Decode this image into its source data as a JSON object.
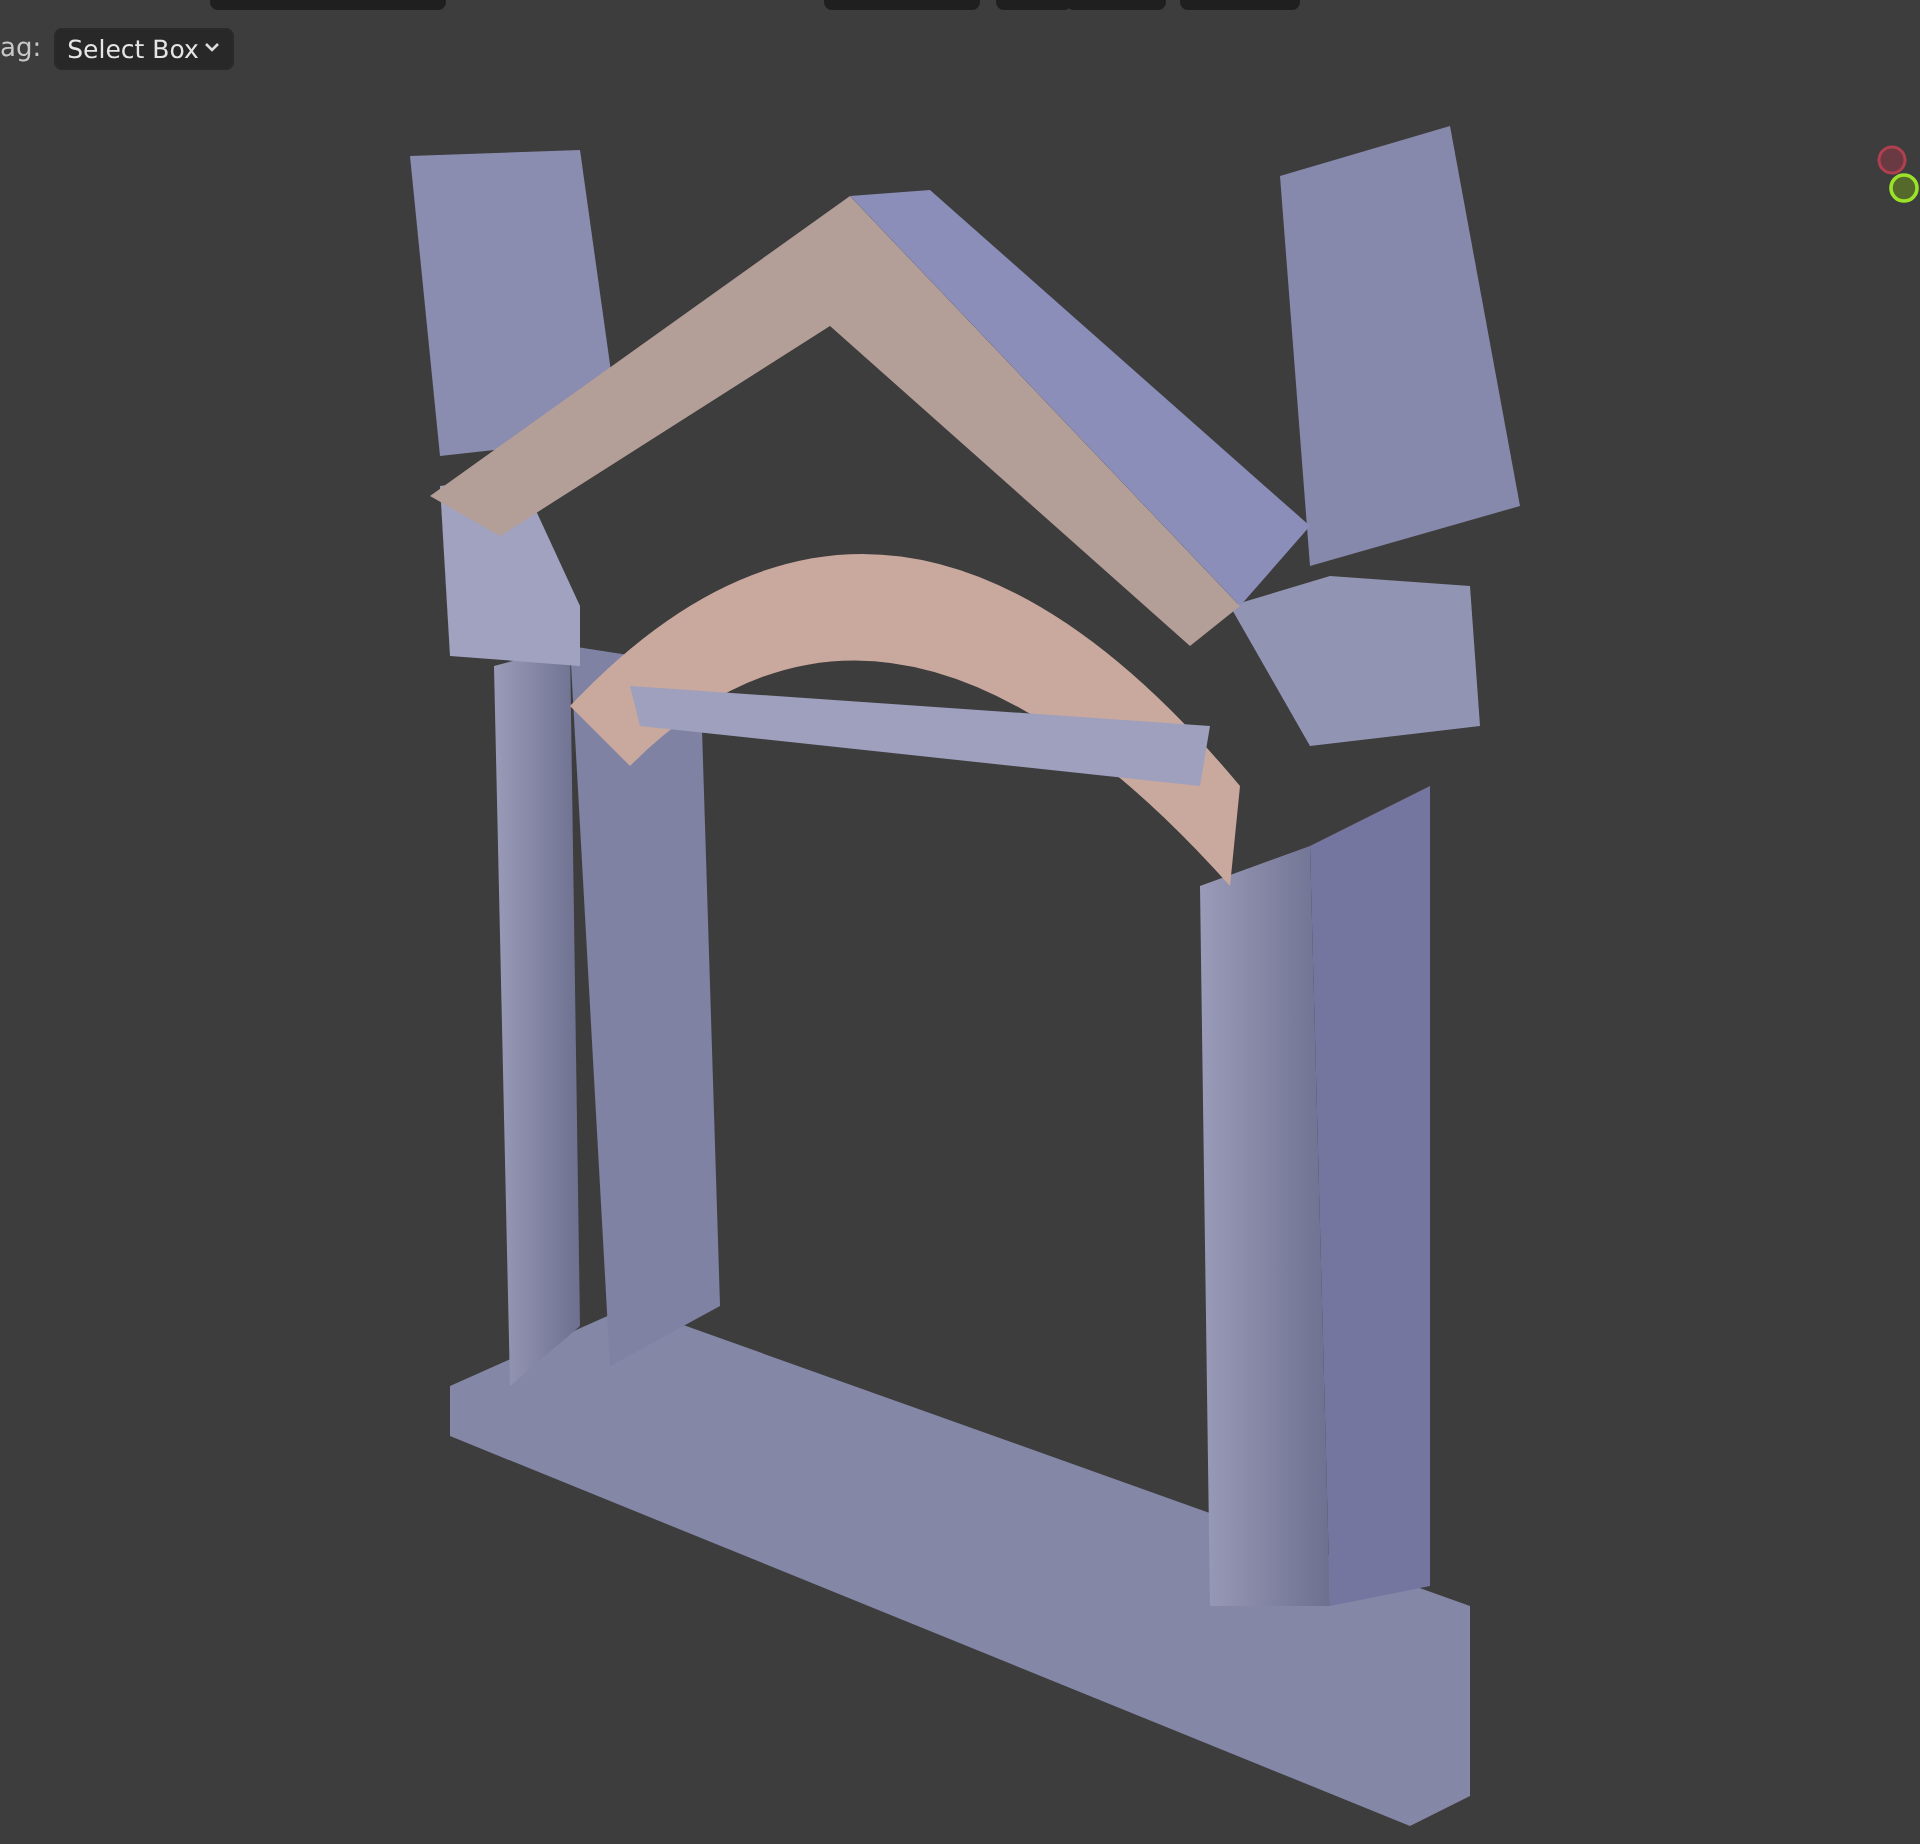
{
  "tool_settings": {
    "drag_label": "ag:",
    "drag_value": "Select Box"
  }
}
